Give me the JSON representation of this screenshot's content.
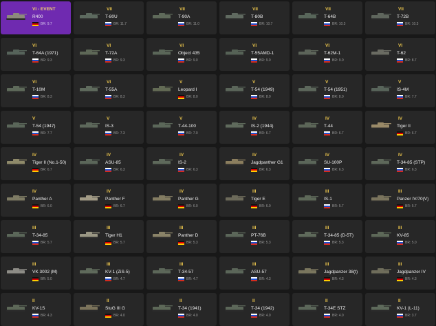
{
  "cards": [
    {
      "rank": "VI - EVENT",
      "name": "R400",
      "nation": "germany",
      "br": "BR: 9.7",
      "event": true,
      "tank_color": "#8d8a7c"
    },
    {
      "rank": "VII",
      "name": "T-80U",
      "nation": "ussr",
      "br": "BR: 11.7",
      "tank_color": "#5d6a5f"
    },
    {
      "rank": "VII",
      "name": "T-90A",
      "nation": "ussr",
      "br": "BR: 11.0",
      "tank_color": "#5f6a5a"
    },
    {
      "rank": "VII",
      "name": "T-80B",
      "nation": "ussr",
      "br": "BR: 10.7",
      "tank_color": "#606a60"
    },
    {
      "rank": "VII",
      "name": "T-64B",
      "nation": "ussr",
      "br": "BR: 10.3",
      "tank_color": "#58665a"
    },
    {
      "rank": "VII",
      "name": "T-72B",
      "nation": "ussr",
      "br": "BR: 10.3",
      "tank_color": "#5f665d"
    },
    {
      "rank": "VI",
      "name": "T-64A (1971)",
      "nation": "ussr",
      "br": "BR: 9.3",
      "tank_color": "#56635a"
    },
    {
      "rank": "VI",
      "name": "T-72A",
      "nation": "ussr",
      "br": "BR: 9.3",
      "tank_color": "#5e6857"
    },
    {
      "rank": "VI",
      "name": "Object 435",
      "nation": "ussr",
      "br": "BR: 9.0",
      "tank_color": "#5a6658"
    },
    {
      "rank": "VI",
      "name": "T-55AMD-1",
      "nation": "ussr",
      "br": "BR: 9.0",
      "tank_color": "#566256"
    },
    {
      "rank": "VI",
      "name": "T-62M-1",
      "nation": "ussr",
      "br": "BR: 9.0",
      "tank_color": "#5c6459"
    },
    {
      "rank": "VI",
      "name": "T-62",
      "nation": "ussr",
      "br": "BR: 8.7",
      "tank_color": "#6a6b62"
    },
    {
      "rank": "VI",
      "name": "T-10M",
      "nation": "ussr",
      "br": "BR: 8.3",
      "tank_color": "#5e6a5a"
    },
    {
      "rank": "VI",
      "name": "T-55A",
      "nation": "ussr",
      "br": "BR: 8.3",
      "tank_color": "#5f6b5d"
    },
    {
      "rank": "V",
      "name": "Leopard I",
      "nation": "germany",
      "br": "BR: 8.0",
      "tank_color": "#636b55"
    },
    {
      "rank": "V",
      "name": "T-54 (1949)",
      "nation": "ussr",
      "br": "BR: 8.0",
      "tank_color": "#5b665a"
    },
    {
      "rank": "V",
      "name": "T-54 (1951)",
      "nation": "ussr",
      "br": "BR: 8.0",
      "tank_color": "#5c675b"
    },
    {
      "rank": "V",
      "name": "IS-4M",
      "nation": "ussr",
      "br": "BR: 7.7",
      "tank_color": "#58645a"
    },
    {
      "rank": "V",
      "name": "T-54 (1947)",
      "nation": "ussr",
      "br": "BR: 7.7",
      "tank_color": "#5a6659"
    },
    {
      "rank": "V",
      "name": "IS-3",
      "nation": "ussr",
      "br": "BR: 7.3",
      "tank_color": "#5d685b"
    },
    {
      "rank": "V",
      "name": "T-44-100",
      "nation": "ussr",
      "br": "BR: 7.0",
      "tank_color": "#5b6759"
    },
    {
      "rank": "IV",
      "name": "IS-2 (1944)",
      "nation": "ussr",
      "br": "BR: 6.7",
      "tank_color": "#5f6a5c"
    },
    {
      "rank": "IV",
      "name": "T-44",
      "nation": "ussr",
      "br": "BR: 6.7",
      "tank_color": "#5c6658"
    },
    {
      "rank": "IV",
      "name": "Tiger II",
      "nation": "germany",
      "br": "BR: 6.7",
      "tank_color": "#9a8a68"
    },
    {
      "rank": "IV",
      "name": "Tiger II (No.1-50)",
      "nation": "germany",
      "br": "BR: 6.7",
      "tank_color": "#8f8a6a"
    },
    {
      "rank": "IV",
      "name": "ASU-85",
      "nation": "ussr",
      "br": "BR: 6.3",
      "tank_color": "#5b6659"
    },
    {
      "rank": "IV",
      "name": "IS-2",
      "nation": "ussr",
      "br": "BR: 6.3",
      "tank_color": "#5e695b"
    },
    {
      "rank": "IV",
      "name": "Jagdpanther G1",
      "nation": "germany",
      "br": "BR: 6.3",
      "tank_color": "#8b7e5e"
    },
    {
      "rank": "IV",
      "name": "SU-100P",
      "nation": "ussr",
      "br": "BR: 6.3",
      "tank_color": "#5b6659"
    },
    {
      "rank": "IV",
      "name": "T-34-85 (STP)",
      "nation": "ussr",
      "br": "BR: 6.3",
      "tank_color": "#5e685a"
    },
    {
      "rank": "IV",
      "name": "Panther A",
      "nation": "germany",
      "br": "BR: 6.0",
      "tank_color": "#7e7b64"
    },
    {
      "rank": "IV",
      "name": "Panther F",
      "nation": "germany",
      "br": "BR: 6.7",
      "tank_color": "#a29b86"
    },
    {
      "rank": "IV",
      "name": "Panther G",
      "nation": "germany",
      "br": "BR: 6.0",
      "tank_color": "#837c62"
    },
    {
      "rank": "III",
      "name": "Tiger E",
      "nation": "germany",
      "br": "BR: 6.0",
      "tank_color": "#6c6a5a"
    },
    {
      "rank": "III",
      "name": "IS-1",
      "nation": "ussr",
      "br": "BR: 5.7",
      "tank_color": "#5d6858"
    },
    {
      "rank": "III",
      "name": "Panzer IV/70(V)",
      "nation": "germany",
      "br": "BR: 5.7",
      "tank_color": "#7a745d"
    },
    {
      "rank": "III",
      "name": "T-34-85",
      "nation": "ussr",
      "br": "BR: 5.7",
      "tank_color": "#5b6759"
    },
    {
      "rank": "III",
      "name": "Tiger H1",
      "nation": "germany",
      "br": "BR: 5.7",
      "tank_color": "#9a9784"
    },
    {
      "rank": "III",
      "name": "Panther D",
      "nation": "germany",
      "br": "BR: 5.3",
      "tank_color": "#8a8368"
    },
    {
      "rank": "III",
      "name": "PT-76B",
      "nation": "ussr",
      "br": "BR: 5.3",
      "tank_color": "#5b6659"
    },
    {
      "rank": "III",
      "name": "T-34-85 (D-5T)",
      "nation": "ussr",
      "br": "BR: 5.3",
      "tank_color": "#5f6a5b"
    },
    {
      "rank": "III",
      "name": "KV-85",
      "nation": "ussr",
      "br": "BR: 5.0",
      "tank_color": "#5d6858"
    },
    {
      "rank": "III",
      "name": "VK 3002 (M)",
      "nation": "germany",
      "br": "BR: 5.0",
      "tank_color": "#8d8c86"
    },
    {
      "rank": "III",
      "name": "KV-1 (ZiS-5)",
      "nation": "ussr",
      "br": "BR: 4.7",
      "tank_color": "#5f6a5b"
    },
    {
      "rank": "III",
      "name": "T-34-57",
      "nation": "ussr",
      "br": "BR: 4.7",
      "tank_color": "#5c6759"
    },
    {
      "rank": "III",
      "name": "ASU-57",
      "nation": "ussr",
      "br": "BR: 4.3",
      "tank_color": "#5b6659"
    },
    {
      "rank": "III",
      "name": "Jagdpanzer 38(t)",
      "nation": "germany",
      "br": "BR: 4.3",
      "tank_color": "#7a765e"
    },
    {
      "rank": "III",
      "name": "Jagdpanzer IV",
      "nation": "germany",
      "br": "BR: 4.3",
      "tank_color": "#6f6d5b"
    },
    {
      "rank": "II",
      "name": "KV-1S",
      "nation": "ussr",
      "br": "BR: 4.3",
      "tank_color": "#5d6858"
    },
    {
      "rank": "II",
      "name": "StuG III G",
      "nation": "germany",
      "br": "BR: 4.0",
      "tank_color": "#7b735b"
    },
    {
      "rank": "II",
      "name": "T-34 (1941)",
      "nation": "ussr",
      "br": "BR: 4.0",
      "tank_color": "#5d6858"
    },
    {
      "rank": "II",
      "name": "T-34 (1942)",
      "nation": "ussr",
      "br": "BR: 4.0",
      "tank_color": "#5c6759"
    },
    {
      "rank": "II",
      "name": "T-34E STZ",
      "nation": "ussr",
      "br": "BR: 4.0",
      "tank_color": "#5b6659"
    },
    {
      "rank": "II",
      "name": "KV-1 (L-11)",
      "nation": "ussr",
      "br": "BR: 3.7",
      "tank_color": "#5e6a5b"
    }
  ]
}
